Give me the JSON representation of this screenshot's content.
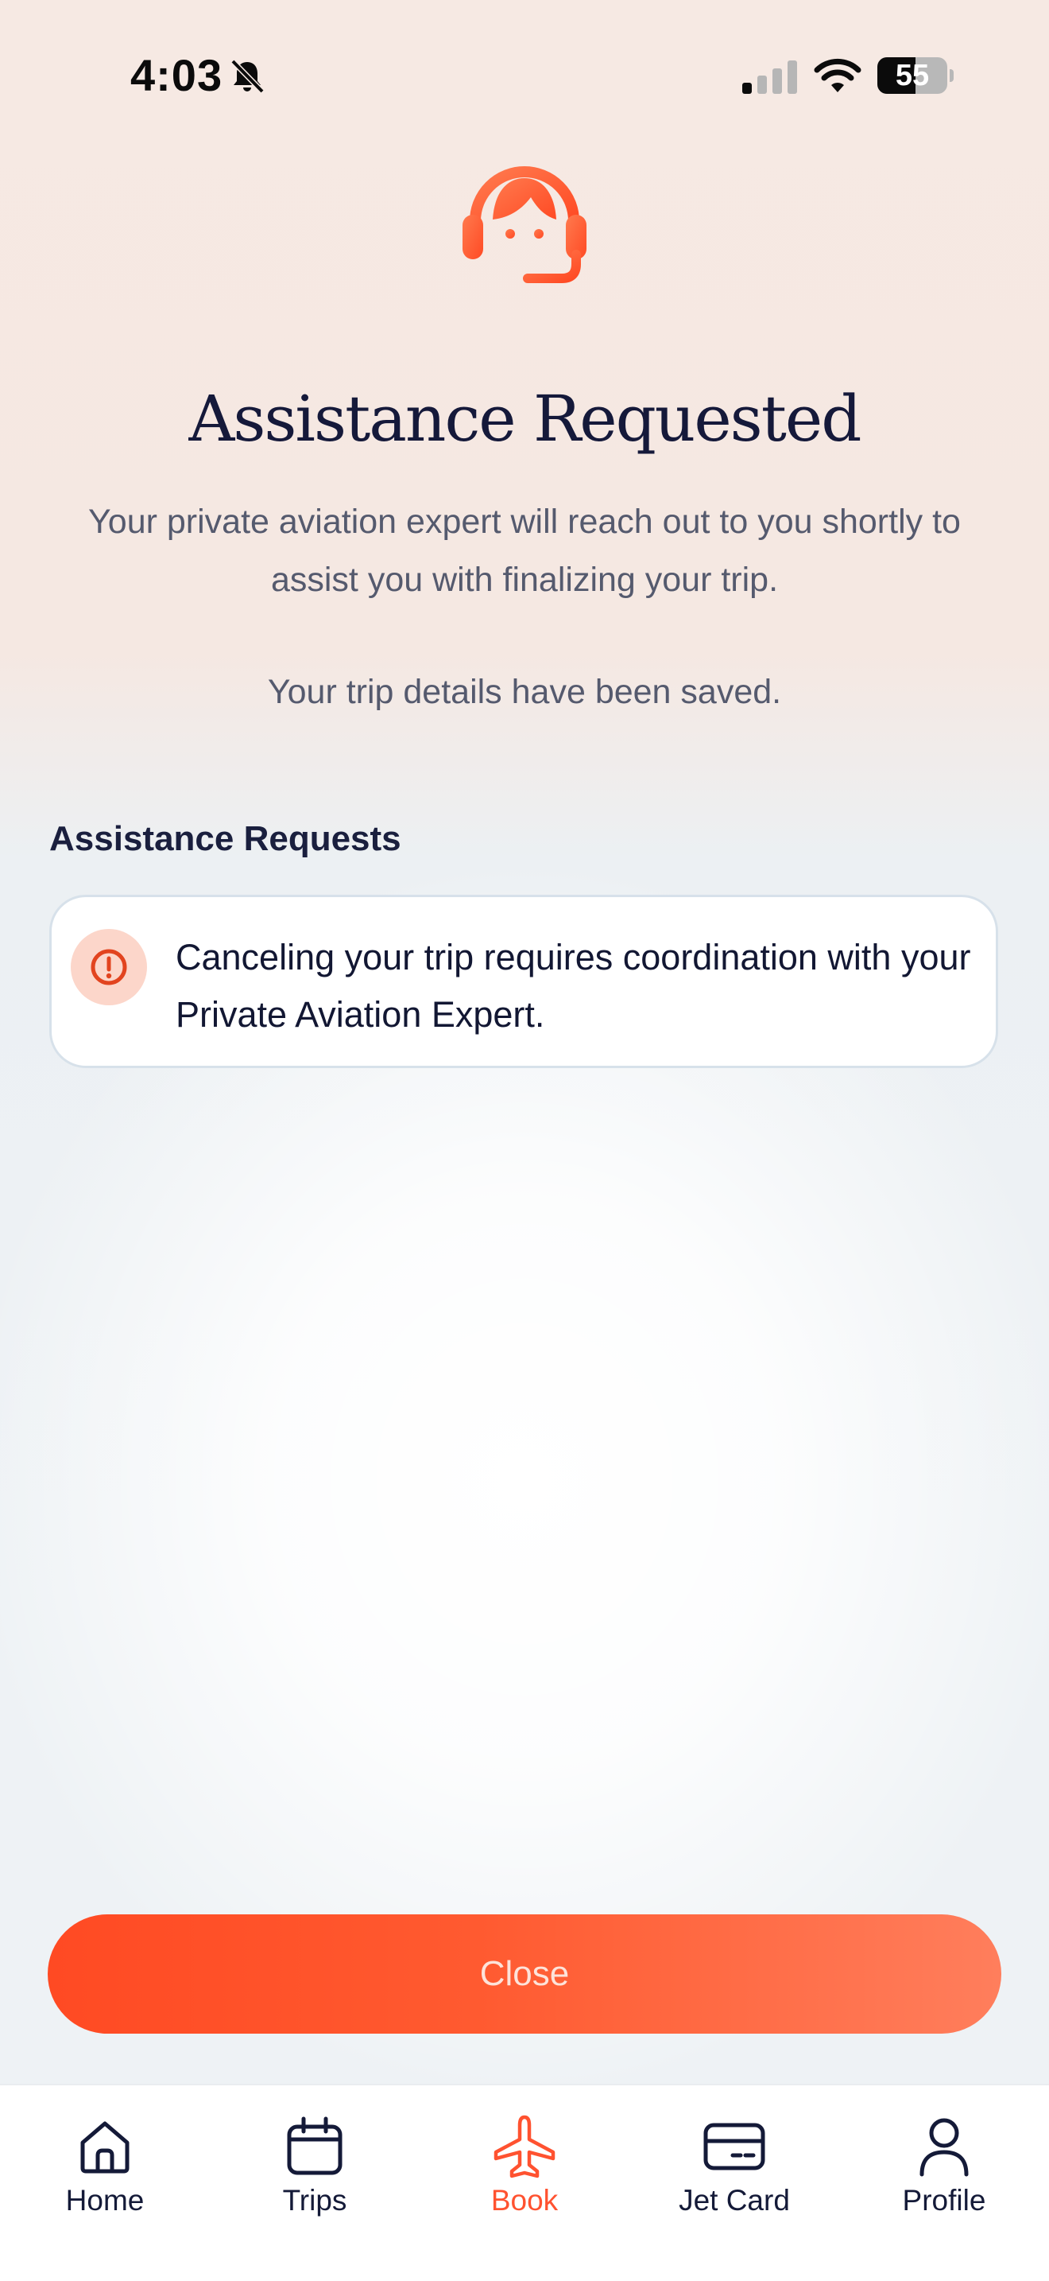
{
  "status_bar": {
    "time": "4:03",
    "battery_level": "55",
    "icons": [
      "bell-slash-icon",
      "cellular-signal-icon",
      "wifi-icon",
      "battery-icon"
    ]
  },
  "hero": {
    "icon": "customer-support-headset-icon",
    "title": "Assistance Requested",
    "subtitle": "Your private aviation expert will reach out to you shortly to assist you with finalizing your trip.",
    "saved_note": "Your trip details have been saved."
  },
  "assistance_requests": {
    "heading": "Assistance Requests",
    "items": [
      {
        "icon": "alert-circle-icon",
        "text": "Canceling your trip requires coordination with your Private Aviation Expert."
      }
    ]
  },
  "actions": {
    "close_label": "Close"
  },
  "tab_bar": {
    "active": "Book",
    "items": [
      {
        "label": "Home",
        "icon": "home-icon"
      },
      {
        "label": "Trips",
        "icon": "calendar-icon"
      },
      {
        "label": "Book",
        "icon": "airplane-icon"
      },
      {
        "label": "Jet Card",
        "icon": "credit-card-icon"
      },
      {
        "label": "Profile",
        "icon": "person-icon"
      }
    ]
  },
  "colors": {
    "accent": "#ff5230",
    "title_text": "#15193a",
    "body_text": "#555a6e",
    "alert_badge": "#fcd6ca"
  }
}
